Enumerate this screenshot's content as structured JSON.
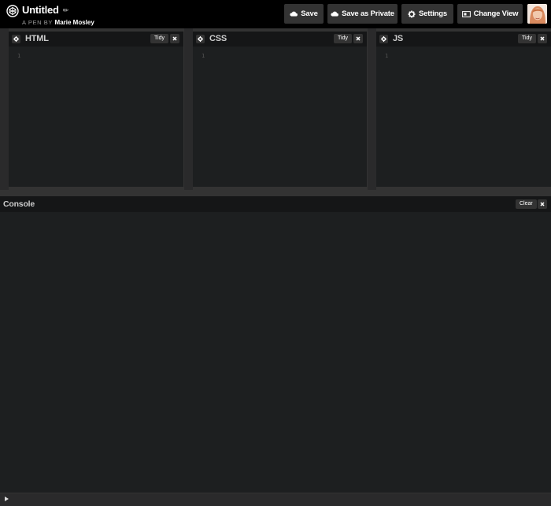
{
  "header": {
    "title": "Untitled",
    "byline_prefix": "A PEN BY",
    "author": "Marie Mosley",
    "buttons": {
      "save": "Save",
      "save_private": "Save as Private",
      "settings": "Settings",
      "change_view": "Change View"
    }
  },
  "editors": [
    {
      "name": "HTML",
      "tidy": "Tidy",
      "line": "1"
    },
    {
      "name": "CSS",
      "tidy": "Tidy",
      "line": "1"
    },
    {
      "name": "JS",
      "tidy": "Tidy",
      "line": "1"
    }
  ],
  "console": {
    "title": "Console",
    "clear_label": "Clear"
  },
  "colors": {
    "header_bg": "#000000",
    "button_bg": "#333333",
    "editor_bg": "#1d1f20"
  },
  "icons": {
    "logo": "codepen-logo-icon",
    "pencil": "pencil-icon",
    "cloud": "cloud-icon",
    "gear": "gear-icon",
    "view": "change-view-icon",
    "close": "close-icon",
    "prompt": "play-arrow-icon"
  }
}
